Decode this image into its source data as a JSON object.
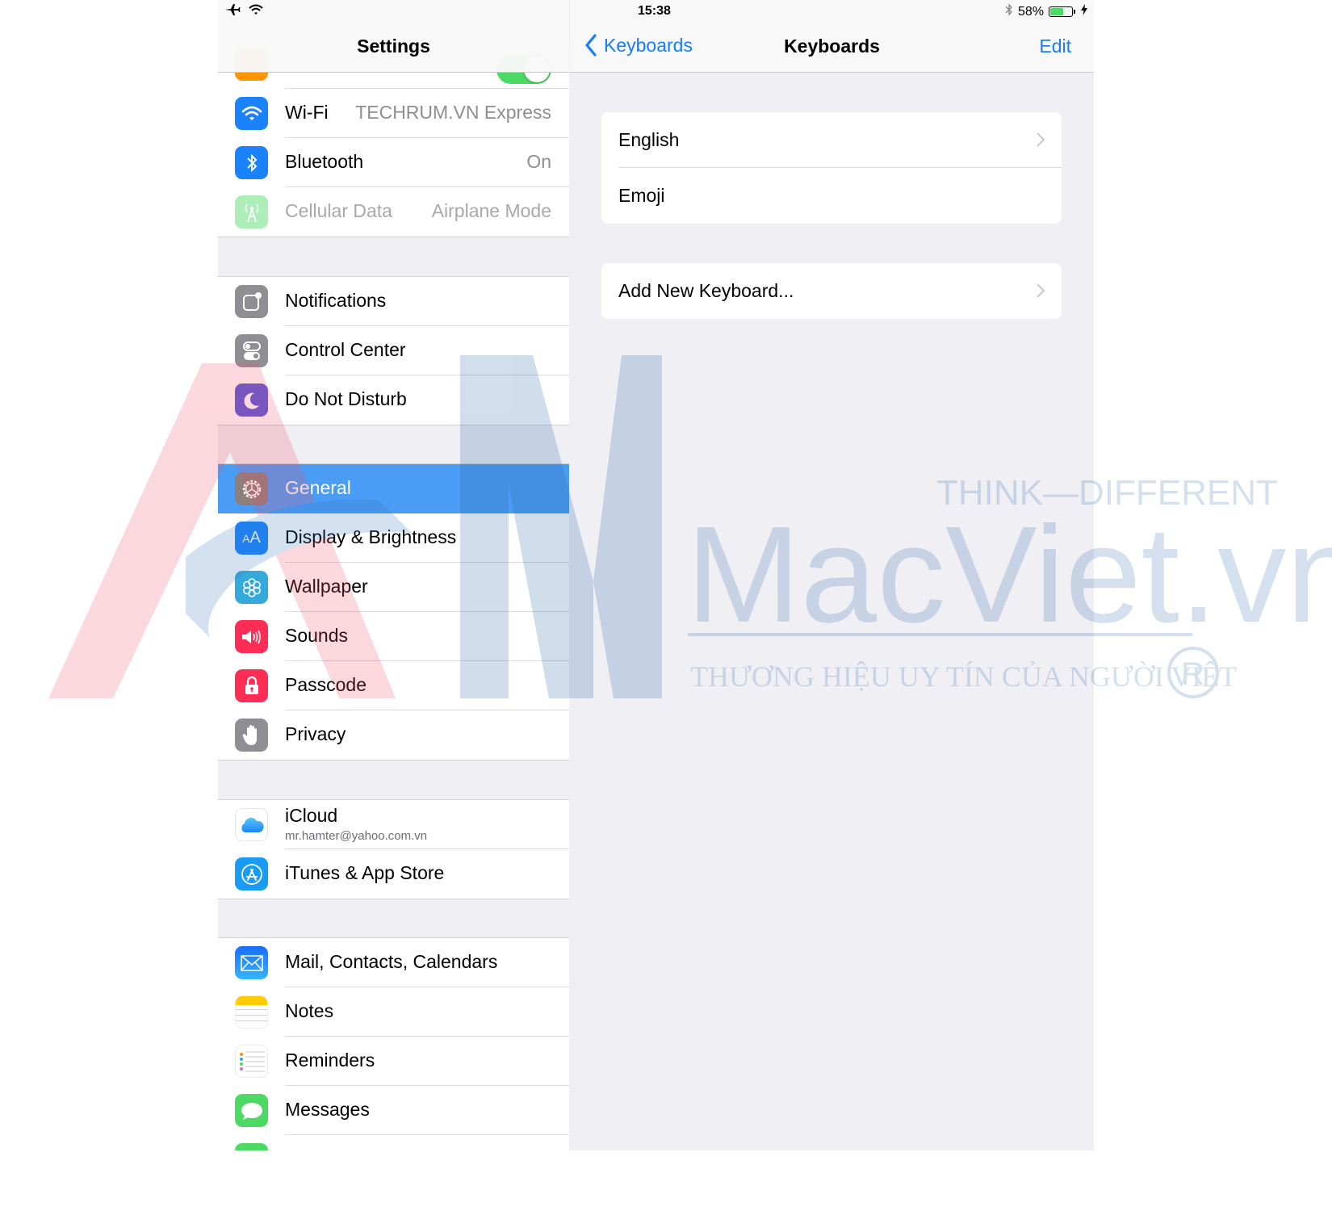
{
  "status_bar": {
    "time": "15:38",
    "battery_percent_label": "58%",
    "battery_level": 0.58,
    "icons": [
      "airplane-icon",
      "wifi-icon",
      "bluetooth-icon",
      "battery-icon",
      "charging-bolt-icon"
    ]
  },
  "master": {
    "title": "Settings",
    "partial_top_row": {
      "icon": "airplane-mode-icon",
      "toggle_on": true
    },
    "groups": [
      {
        "items": [
          {
            "label": "Wi-Fi",
            "value": "TECHRUM.VN Express",
            "icon": "wifi-icon",
            "color": "#1a82fb"
          },
          {
            "label": "Bluetooth",
            "value": "On",
            "icon": "bluetooth-icon",
            "color": "#1a82fb"
          },
          {
            "label": "Cellular Data",
            "value": "Airplane Mode",
            "icon": "cellular-antenna-icon",
            "color": "#4cd964",
            "disabled": true
          }
        ]
      },
      {
        "items": [
          {
            "label": "Notifications",
            "icon": "notifications-icon",
            "color": "#8e8e93"
          },
          {
            "label": "Control Center",
            "icon": "control-center-icon",
            "color": "#8e8e93"
          },
          {
            "label": "Do Not Disturb",
            "icon": "moon-icon",
            "color": "#5856d6"
          }
        ]
      },
      {
        "items": [
          {
            "label": "General",
            "icon": "gear-icon",
            "color": "#8e8e93",
            "selected": true
          },
          {
            "label": "Display & Brightness",
            "icon": "text-size-icon",
            "color": "#1a82fb"
          },
          {
            "label": "Wallpaper",
            "icon": "flower-icon",
            "color": "#34aadc"
          },
          {
            "label": "Sounds",
            "icon": "speaker-icon",
            "color": "#ff2d55"
          },
          {
            "label": "Passcode",
            "icon": "lock-icon",
            "color": "#ff2d55"
          },
          {
            "label": "Privacy",
            "icon": "hand-icon",
            "color": "#8e8e93"
          }
        ]
      },
      {
        "items": [
          {
            "label": "iCloud",
            "sublabel": "mr.hamter@yahoo.com.vn",
            "icon": "cloud-icon",
            "color": "#ffffff"
          },
          {
            "label": "iTunes & App Store",
            "icon": "app-store-icon",
            "color": "#1a9cf5"
          }
        ]
      },
      {
        "items": [
          {
            "label": "Mail, Contacts, Calendars",
            "icon": "mail-icon",
            "color": "#1a82fb"
          },
          {
            "label": "Notes",
            "icon": "notes-icon",
            "color": "#ffffff"
          },
          {
            "label": "Reminders",
            "icon": "reminders-icon",
            "color": "#ffffff"
          },
          {
            "label": "Messages",
            "icon": "messages-icon",
            "color": "#4cd964"
          }
        ]
      }
    ]
  },
  "detail": {
    "back_label": "Keyboards",
    "title": "Keyboards",
    "edit_label": "Edit",
    "keyboards": [
      {
        "label": "English",
        "has_chevron": true
      },
      {
        "label": "Emoji",
        "has_chevron": false
      }
    ],
    "add_keyboard_label": "Add New Keyboard..."
  },
  "watermark": {
    "brand": "MacViet.vn",
    "tagline": "THINK—DIFFERENT",
    "slogan": "THƯƠNG HIỆU UY TÍN CỦA NGƯỜI VIỆT",
    "registered_mark": "R"
  },
  "colors": {
    "accent": "#147efb",
    "selected_row": "#4a9cf5",
    "group_background": "#efeff4",
    "toggle_on": "#4cd964"
  }
}
